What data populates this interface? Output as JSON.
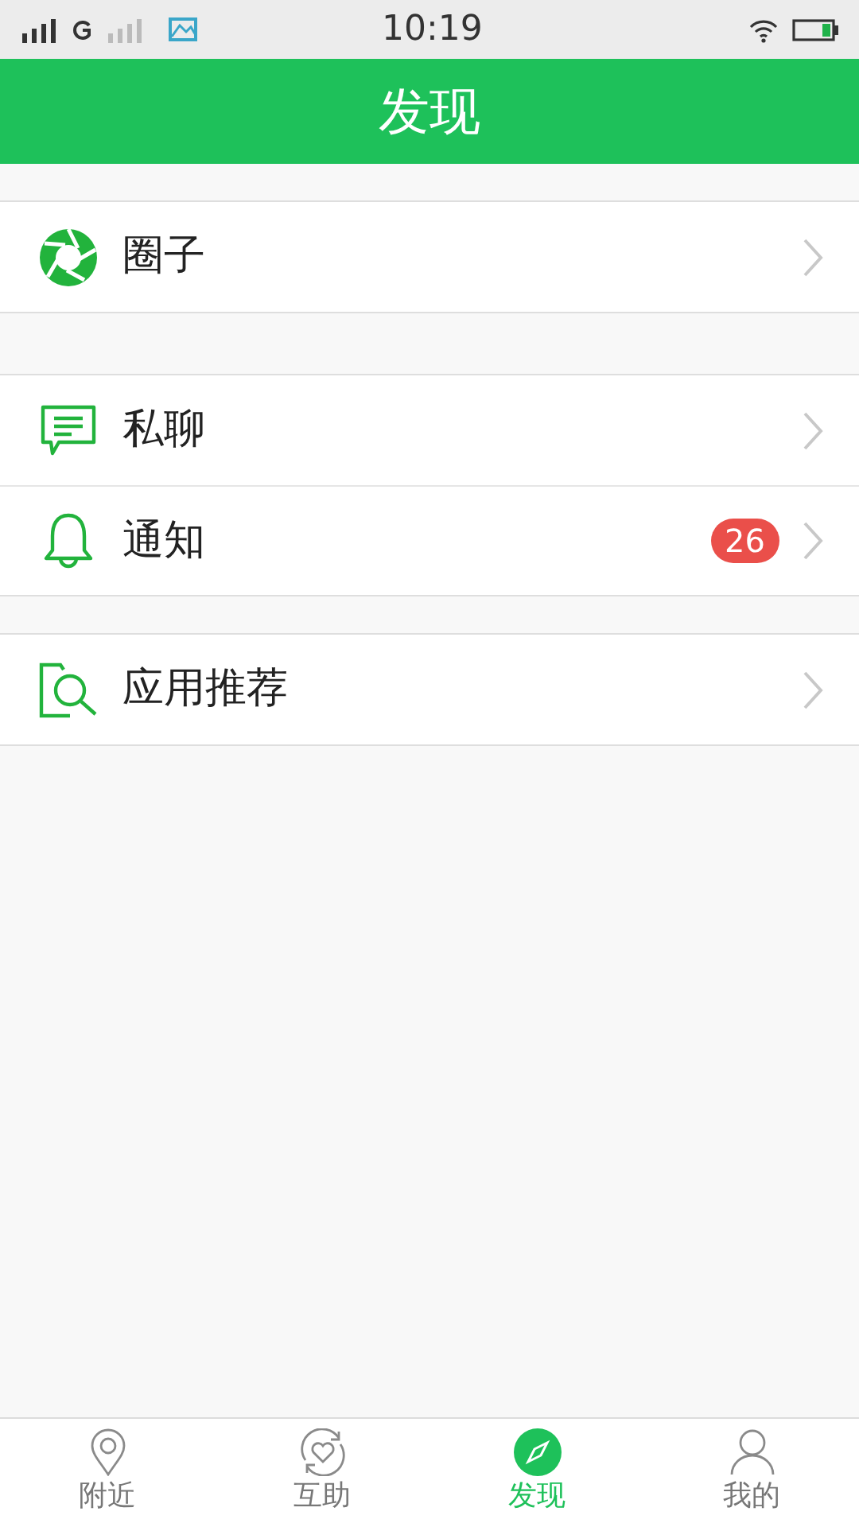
{
  "status_bar": {
    "time": "10:19"
  },
  "header": {
    "title": "发现"
  },
  "groups": [
    {
      "items": [
        {
          "label": "圈子"
        }
      ]
    },
    {
      "items": [
        {
          "label": "私聊"
        },
        {
          "label": "通知",
          "badge": "26"
        }
      ]
    },
    {
      "items": [
        {
          "label": "应用推荐"
        }
      ]
    }
  ],
  "tabs": [
    {
      "label": "附近",
      "selected": false
    },
    {
      "label": "互助",
      "selected": false
    },
    {
      "label": "发现",
      "selected": true
    },
    {
      "label": "我的",
      "selected": false
    }
  ]
}
